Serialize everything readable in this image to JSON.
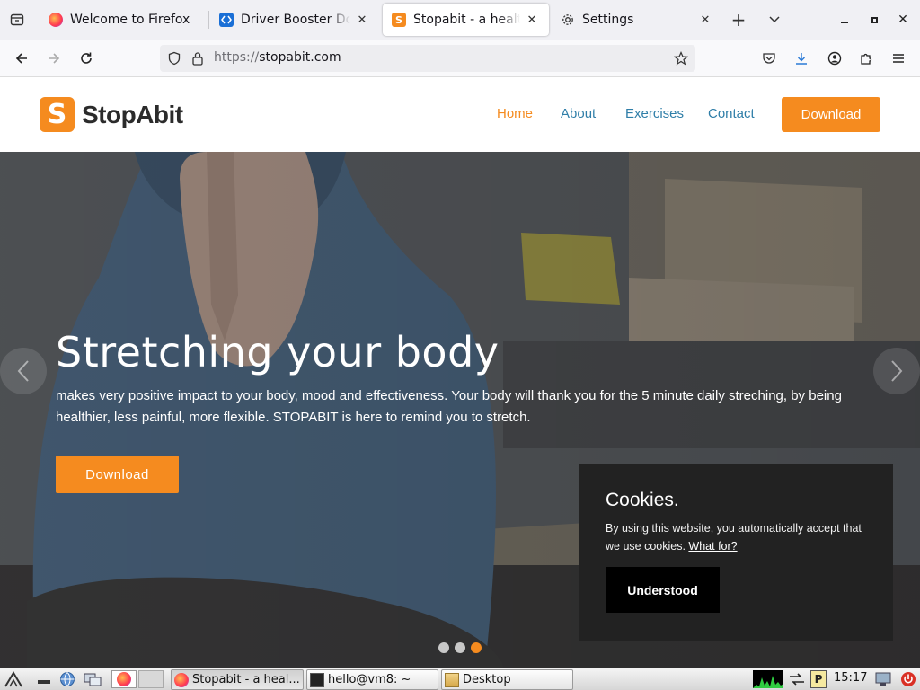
{
  "browser": {
    "tabs": [
      {
        "title": "Welcome to Firefox",
        "favicon": "firefox-icon"
      },
      {
        "title": "Driver Booster Dow",
        "favicon": "driver-booster-icon"
      },
      {
        "title": "Stopabit - a healthi",
        "favicon": "stopabit-icon",
        "active": true
      },
      {
        "title": "Settings",
        "favicon": "gear-icon"
      }
    ],
    "url_protocol": "https://",
    "url_host": "stopabit.com"
  },
  "site": {
    "logo_letter": "S",
    "logo_text": "StopAbit",
    "menu": [
      "Home",
      "About",
      "Exercises",
      "Contact"
    ],
    "active_menu": "Home",
    "header_download": "Download",
    "brand_color": "#f58b1f",
    "link_color": "#2f7ea8"
  },
  "hero": {
    "title": "Stretching your body",
    "text": "makes very positive impact to your body, mood and effectiveness. Your body will thank you for the 5 minute daily streching, by being healthier, less painful, more flexible. STOPABIT is here to remind you to stretch.",
    "download": "Download",
    "slides_count": 3,
    "active_slide": 3
  },
  "cookies": {
    "title": "Cookies.",
    "text": "By using this website, you automatically accept that we use cookies.",
    "link": "What for?",
    "button": "Understood"
  },
  "taskbar": {
    "tasks": [
      {
        "label": "Stopabit - a heal...",
        "icon": "firefox-icon"
      },
      {
        "label": "hello@vm8: ~",
        "icon": "terminal-icon"
      },
      {
        "label": "Desktop",
        "icon": "folder-icon"
      }
    ],
    "clock": "15:17"
  }
}
